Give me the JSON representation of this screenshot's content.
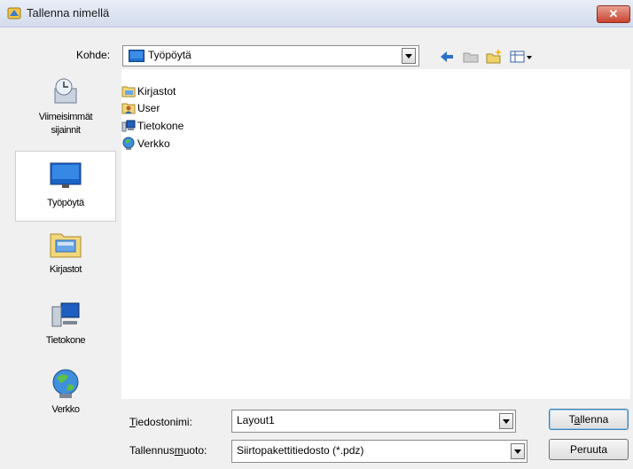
{
  "window": {
    "title": "Tallenna nimellä",
    "close_symbol": "✕"
  },
  "location": {
    "label": "Kohde:",
    "value": "Työpöytä"
  },
  "places": [
    {
      "label_lines": [
        "Viimeisimmät",
        "sijainnit"
      ],
      "icon": "recent-places-icon"
    },
    {
      "label_lines": [
        "Työpöytä"
      ],
      "icon": "desktop-icon"
    },
    {
      "label_lines": [
        "Kirjastot"
      ],
      "icon": "libraries-icon"
    },
    {
      "label_lines": [
        "Tietokone"
      ],
      "icon": "computer-icon"
    },
    {
      "label_lines": [
        "Verkko"
      ],
      "icon": "network-icon"
    }
  ],
  "files": [
    {
      "name": "Kirjastot",
      "icon": "libraries-icon"
    },
    {
      "name": "User",
      "icon": "user-folder-icon"
    },
    {
      "name": "Tietokone",
      "icon": "computer-icon"
    },
    {
      "name": "Verkko",
      "icon": "network-icon"
    }
  ],
  "filename": {
    "label_pre": "",
    "label_key": "T",
    "label_post": "iedostonimi:",
    "value": "Layout1"
  },
  "filetype": {
    "label_pre": "Tallennus",
    "label_key": "m",
    "label_post": "uoto:",
    "value": "Siirtopakettitiedosto (*.pdz)"
  },
  "buttons": {
    "save_pre": "T",
    "save_key": "a",
    "save_post": "llenna",
    "cancel": "Peruuta"
  },
  "colors": {
    "accent": "#1c5ea8",
    "close": "#c9432f"
  }
}
